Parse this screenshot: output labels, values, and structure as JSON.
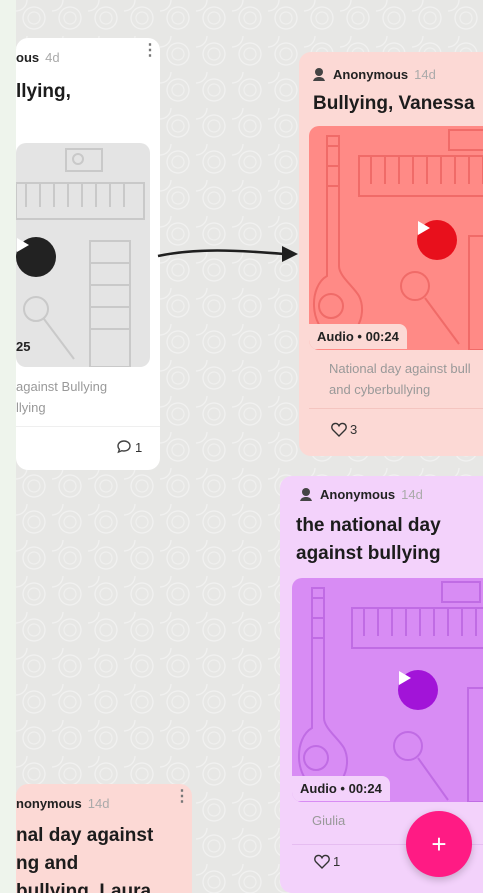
{
  "cards": {
    "left": {
      "author_partial": "ous",
      "age": "4d",
      "title_partial": "llying,",
      "audio_time_partial": "25",
      "desc_line1": "against Bullying",
      "desc_line2": "llying",
      "comments": "1"
    },
    "right_top": {
      "author": "Anonymous",
      "age": "14d",
      "title": "Bullying, Vanessa",
      "audio_label": "Audio • 00:24",
      "desc_line1": "National day against bull",
      "desc_line2": "and cyberbullying",
      "likes": "3"
    },
    "right_bottom": {
      "author": "Anonymous",
      "age": "14d",
      "title_line1": "the national day",
      "title_line2": "against bullying",
      "audio_label": "Audio • 00:24",
      "signature": "Giulia",
      "likes": "1"
    },
    "bottom_left": {
      "author_partial": "nonymous",
      "age": "14d",
      "title_line1": "nal day against",
      "title_line2": "ng and",
      "title_line3": "bullying, Laura"
    }
  },
  "fab": {
    "label": "+"
  },
  "colors": {
    "pink_card": "#fcd9d5",
    "pink_media": "#ff8a86",
    "pink_play": "#e8101c",
    "purple_card": "#f3d2fb",
    "purple_media": "#d88cf4",
    "purple_play": "#a214d8",
    "gray_media": "#e4e4e4",
    "fab": "#ff1b84"
  }
}
